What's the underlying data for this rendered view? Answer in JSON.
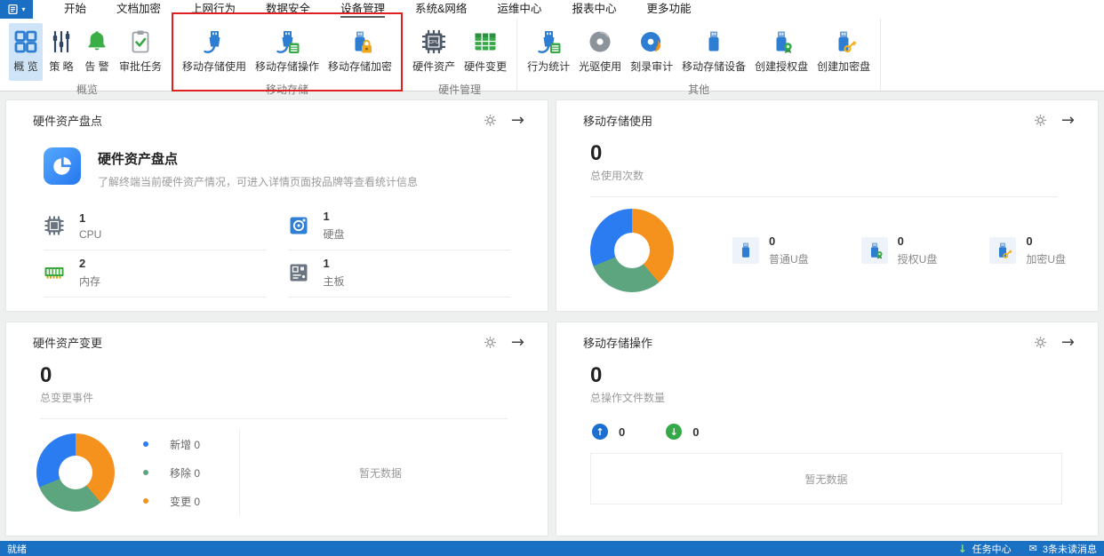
{
  "menu": {
    "items": [
      {
        "label": "开始"
      },
      {
        "label": "文档加密"
      },
      {
        "label": "上网行为"
      },
      {
        "label": "数据安全"
      },
      {
        "label": "设备管理"
      },
      {
        "label": "系统&网络"
      },
      {
        "label": "运维中心"
      },
      {
        "label": "报表中心"
      },
      {
        "label": "更多功能"
      }
    ],
    "active_item": "设备管理"
  },
  "ribbon": {
    "highlight_color": "#e01f1f",
    "selected_button": "概 览",
    "groups": [
      {
        "label": "概览",
        "buttons": [
          {
            "label": "概 览",
            "icon": "overview-grid-icon"
          },
          {
            "label": "策 略",
            "icon": "policy-sliders-icon"
          },
          {
            "label": "告 警",
            "icon": "alert-bell-icon"
          },
          {
            "label": "审批任务",
            "icon": "approval-clipboard-icon"
          }
        ]
      },
      {
        "label": "移动存储",
        "highlighted": true,
        "buttons": [
          {
            "label": "移动存储使用",
            "icon": "usb-cable-icon"
          },
          {
            "label": "移动存储操作",
            "icon": "usb-table-icon"
          },
          {
            "label": "移动存储加密",
            "icon": "usb-lock-icon"
          }
        ]
      },
      {
        "label": "硬件管理",
        "buttons": [
          {
            "label": "硬件资产",
            "icon": "cpu-chip-icon"
          },
          {
            "label": "硬件变更",
            "icon": "green-table-icon"
          }
        ]
      },
      {
        "label": "其他",
        "buttons": [
          {
            "label": "行为统计",
            "icon": "usb-stats-icon"
          },
          {
            "label": "光驱使用",
            "icon": "disc-icon"
          },
          {
            "label": "刻录审计",
            "icon": "disc-burn-icon"
          },
          {
            "label": "移动存储设备",
            "icon": "usb-device-icon"
          },
          {
            "label": "创建授权盘",
            "icon": "usb-authorize-icon"
          },
          {
            "label": "创建加密盘",
            "icon": "usb-key-icon"
          }
        ]
      }
    ]
  },
  "cards": {
    "hardware_inventory": {
      "title": "硬件资产盘点",
      "hero_title": "硬件资产盘点",
      "hero_desc": "了解终端当前硬件资产情况，可进入详情页面按品牌等查看统计信息",
      "items": [
        {
          "value": "1",
          "label": "CPU",
          "icon": "cpu-small-icon"
        },
        {
          "value": "1",
          "label": "硬盘",
          "icon": "disk-small-icon"
        },
        {
          "value": "2",
          "label": "内存",
          "icon": "ram-small-icon"
        },
        {
          "value": "1",
          "label": "主板",
          "icon": "motherboard-small-icon"
        }
      ]
    },
    "storage_usage": {
      "title": "移动存储使用",
      "total_value": "0",
      "total_label": "总使用次数",
      "stats": [
        {
          "value": "0",
          "label": "普通U盘",
          "icon": "usb-plain-icon"
        },
        {
          "value": "0",
          "label": "授权U盘",
          "icon": "usb-authorized-icon"
        },
        {
          "value": "0",
          "label": "加密U盘",
          "icon": "usb-encrypted-icon"
        }
      ]
    },
    "hardware_change": {
      "title": "硬件资产变更",
      "total_value": "0",
      "total_label": "总变更事件",
      "legend": [
        {
          "name": "新增",
          "value": "0",
          "color": "#2b7cf0"
        },
        {
          "name": "移除",
          "value": "0",
          "color": "#5ca57f"
        },
        {
          "name": "变更",
          "value": "0",
          "color": "#f5921e"
        }
      ],
      "empty_text": "暂无数据"
    },
    "storage_operation": {
      "title": "移动存储操作",
      "total_value": "0",
      "total_label": "总操作文件数量",
      "upload_value": "0",
      "download_value": "0",
      "empty_text": "暂无数据"
    }
  },
  "statusbar": {
    "left": "就绪",
    "task_center": "任务中心",
    "messages": "3条未读消息"
  },
  "chart_data": [
    {
      "type": "pie",
      "title": "移动存储使用",
      "categories": [
        "普通U盘",
        "授权U盘",
        "加密U盘"
      ],
      "values": [
        0,
        0,
        0
      ],
      "note": "empty-state donut rendered as three equal placeholder segments",
      "segment_colors": [
        "#f5921e",
        "#5ca57f",
        "#2b7cf0"
      ],
      "legend_position": "none"
    },
    {
      "type": "pie",
      "title": "硬件资产变更",
      "categories": [
        "新增",
        "移除",
        "变更"
      ],
      "values": [
        0,
        0,
        0
      ],
      "note": "empty-state donut rendered as three equal placeholder segments",
      "segment_colors": [
        "#2b7cf0",
        "#5ca57f",
        "#f5921e"
      ],
      "legend_position": "right"
    }
  ]
}
